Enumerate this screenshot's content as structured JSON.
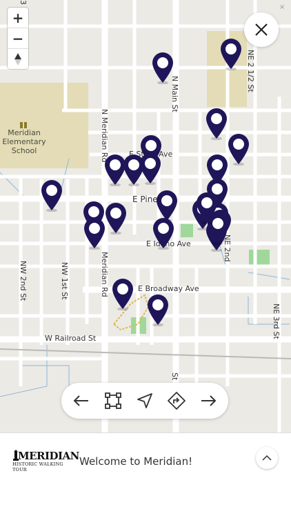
{
  "map": {
    "streets": {
      "n_main": "N Main St",
      "n_meridian": "N Meridian Rd",
      "meridian_rd_south": "Meridian Rd",
      "e_state": "E State Ave",
      "e_pine": "E Pine",
      "e_idaho": "E Idaho Ave",
      "e_broadway": "E Broadway Ave",
      "w_railroad": "W Railroad St",
      "nw_2nd": "NW 2nd St",
      "nw_1st": "NW 1st St",
      "ne_2nd": "NE 2nd",
      "ne_2_half": "NE 2 1/2 St",
      "ne_3rd": "NE 3rd St",
      "s_main": "St",
      "top_left_partial": "3 r"
    },
    "school_label": "Meridian Elementary School",
    "colors": {
      "pin": "#1f1659",
      "school_area": "#e3dcb6",
      "park": "#9fd89a",
      "road": "#ffffff",
      "background": "#ebeae5"
    },
    "pin_count": 24
  },
  "controls": {
    "zoom_in": "+",
    "zoom_out": "−",
    "close_icon": "close-icon"
  },
  "toolbar": {
    "prev_icon": "arrow-left-icon",
    "bounds_icon": "fit-bounds-icon",
    "locate_icon": "navigation-arrow-icon",
    "directions_icon": "directions-icon",
    "next_icon": "arrow-right-icon"
  },
  "footer": {
    "logo_main": "MERIDIAN",
    "logo_sub": "HISTORIC WALKING TOUR",
    "welcome": "Welcome to Meridian!"
  }
}
